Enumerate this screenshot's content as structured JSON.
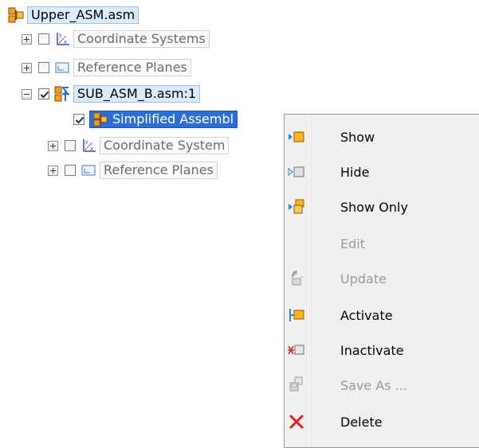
{
  "tree": {
    "root": {
      "label": "Upper_ASM.asm",
      "icon": "assembly-icon"
    },
    "items": [
      {
        "label": "Coordinate Systems",
        "icon": "coordinate-system-icon",
        "checked": false,
        "expander": "plus"
      },
      {
        "label": "Reference Planes",
        "icon": "reference-plane-icon",
        "checked": false,
        "expander": "plus"
      },
      {
        "label": "SUB_ASM_B.asm:1",
        "icon": "sub-assembly-icon",
        "checked": true,
        "expander": "minus"
      },
      {
        "label": "Simplified Assembl",
        "icon": "simplified-assembly-icon",
        "checked": true
      },
      {
        "label": "Coordinate System",
        "icon": "coordinate-system-icon",
        "checked": false,
        "expander": "plus"
      },
      {
        "label": "Reference Planes",
        "icon": "reference-plane-icon",
        "checked": false,
        "expander": "plus"
      }
    ]
  },
  "context_menu": {
    "items": [
      {
        "label": "Show",
        "icon": "show-icon",
        "enabled": true
      },
      {
        "label": "Hide",
        "icon": "hide-icon",
        "enabled": true
      },
      {
        "label": "Show Only",
        "icon": "show-only-icon",
        "enabled": true
      },
      {
        "label": "Edit",
        "icon": "",
        "enabled": false
      },
      {
        "label": "Update",
        "icon": "update-icon",
        "enabled": false
      },
      {
        "label": "Activate",
        "icon": "activate-icon",
        "enabled": true
      },
      {
        "label": "Inactivate",
        "icon": "inactivate-icon",
        "enabled": true
      },
      {
        "label": "Save As ...",
        "icon": "save-as-icon",
        "enabled": false
      },
      {
        "label": "Delete",
        "icon": "delete-icon",
        "enabled": true
      }
    ]
  },
  "colors": {
    "selection": "#2a6ed6",
    "assembly_orange": "#e8890c",
    "delete_red": "#e02020"
  }
}
